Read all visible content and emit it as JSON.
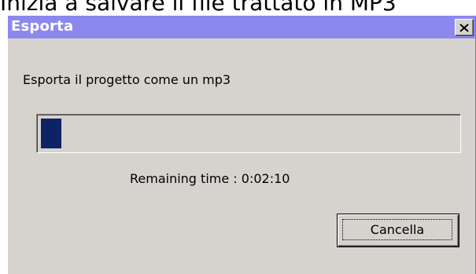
{
  "caption": {
    "text": "Inizia a salvare il file trattato in MP3"
  },
  "dialog": {
    "title": "Esporta",
    "close_icon": "close-icon",
    "message": "Esporta il progetto come un mp3",
    "progress_fraction": 0.05,
    "remaining_time": "Remaining time : 0:02:10",
    "cancel_label": "Cancella"
  },
  "colors": {
    "titlebar": "#8c88ee",
    "title_text": "#ffffff",
    "dialog_face": "#d6d3ce",
    "progress_fill": "#0d2366"
  }
}
